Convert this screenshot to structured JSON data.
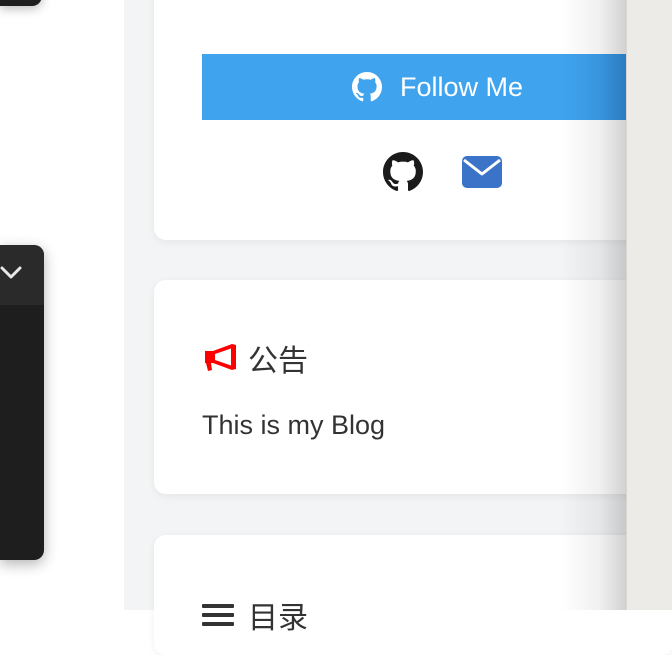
{
  "sidebar_card": {
    "follow_label": "Follow Me",
    "social_links": [
      {
        "icon": "github-icon",
        "color": "#1b1b1b"
      },
      {
        "icon": "envelope-icon",
        "color": "#3a73c7"
      }
    ]
  },
  "notice_card": {
    "title": "公告",
    "icon": "megaphone-icon",
    "icon_color": "#ff0000",
    "text": "This is my Blog"
  },
  "toc_card": {
    "title": "目录",
    "icon": "list-lines-icon"
  },
  "colors": {
    "follow_button": "#3fa3ee",
    "page_background": "#f3f4f5",
    "dark_panel": "#1e1e1e"
  }
}
